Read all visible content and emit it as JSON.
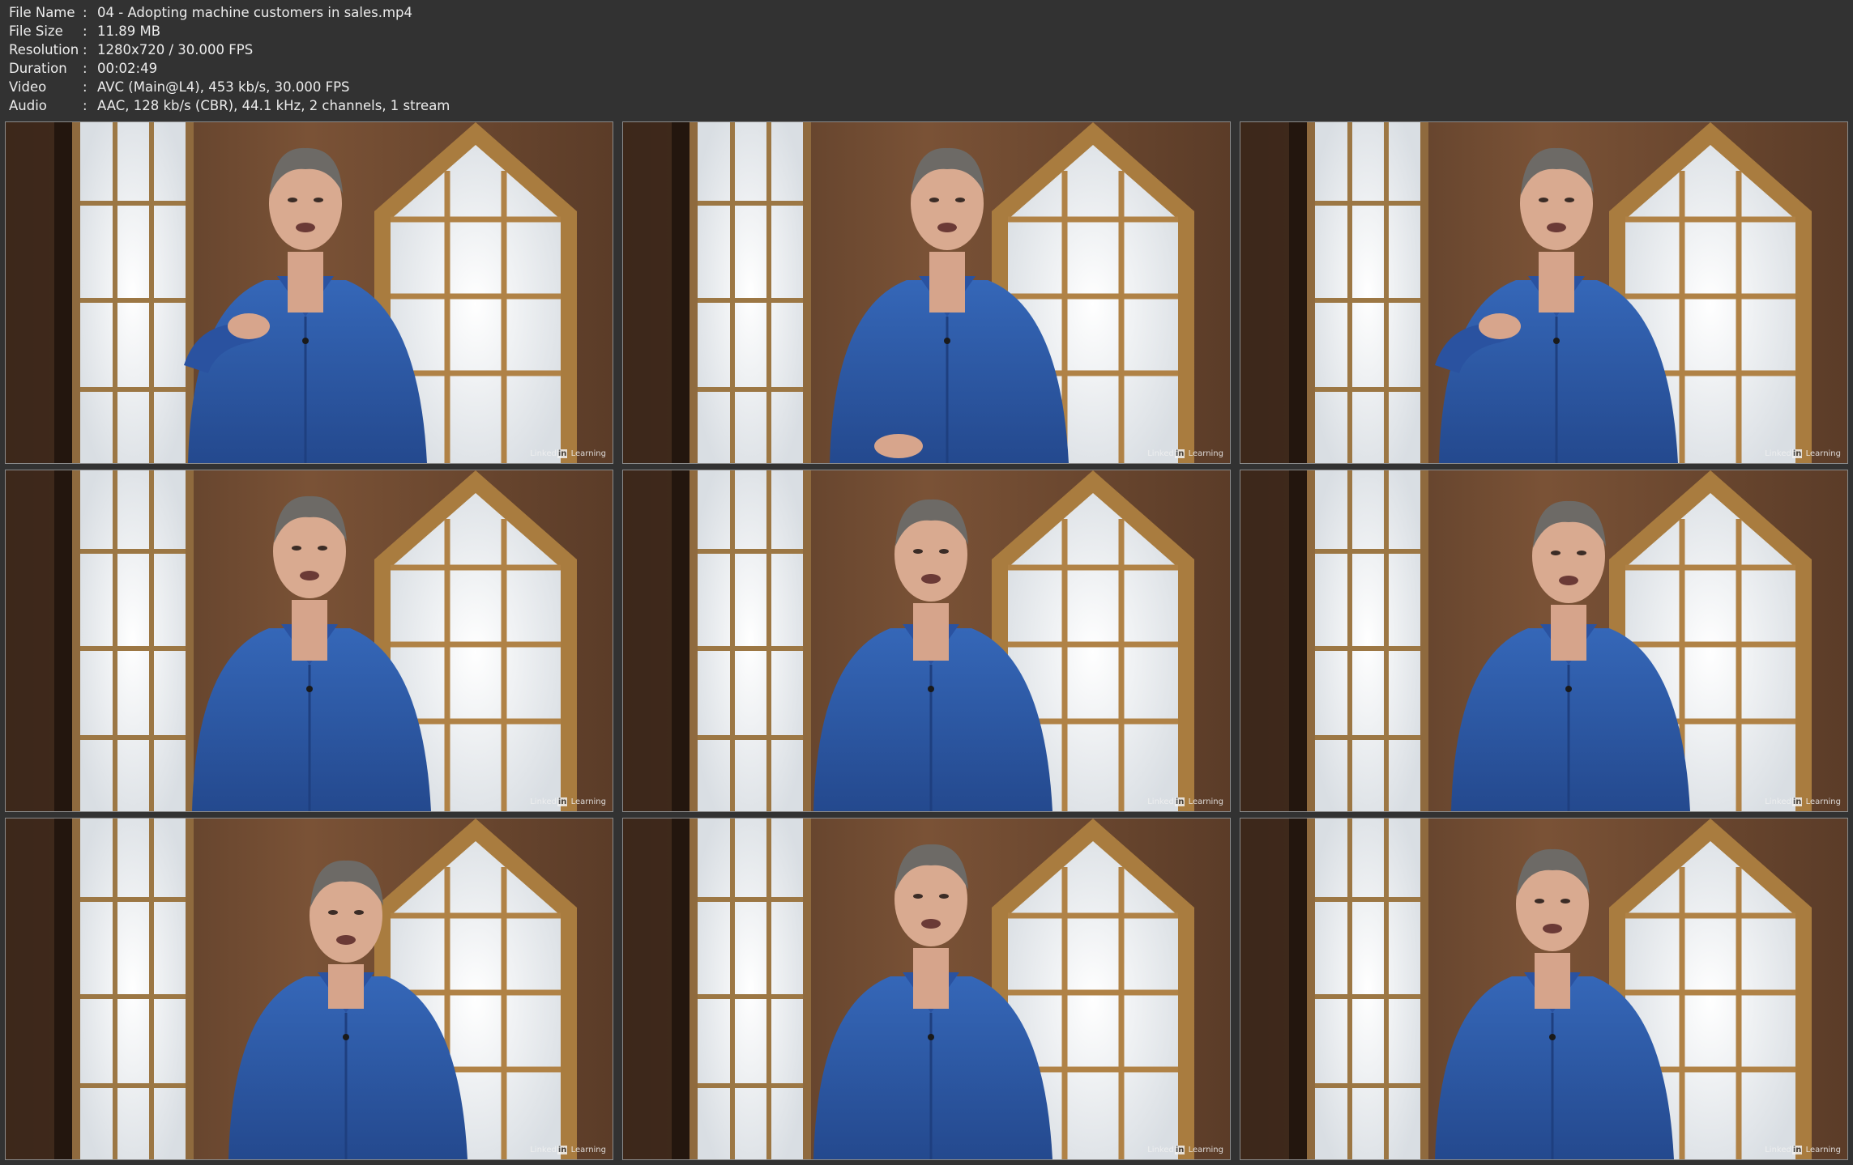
{
  "info": {
    "rows": [
      {
        "label": "File Name",
        "sep": ":",
        "value": "04 - Adopting machine customers in sales.mp4"
      },
      {
        "label": "File Size",
        "sep": ":",
        "value": "11.89 MB"
      },
      {
        "label": "Resolution",
        "sep": ":",
        "value": "1280x720 / 30.000 FPS"
      },
      {
        "label": "Duration",
        "sep": ":",
        "value": "00:02:49"
      },
      {
        "label": "Video",
        "sep": ":",
        "value": "AVC (Main@L4), 453 kb/s, 30.000 FPS"
      },
      {
        "label": "Audio",
        "sep": ":",
        "value": "AAC, 128 kb/s (CBR), 44.1 kHz, 2 channels, 1 stream"
      }
    ]
  },
  "thumbnails": {
    "watermark_left": "Linked",
    "watermark_in": "in",
    "watermark_right": "Learning",
    "count": 9
  },
  "colors": {
    "background": "#323232",
    "text": "#ececec",
    "shirt": "#2f5aa8",
    "brick": "#6e4a33",
    "window_frame": "#b88a47"
  }
}
